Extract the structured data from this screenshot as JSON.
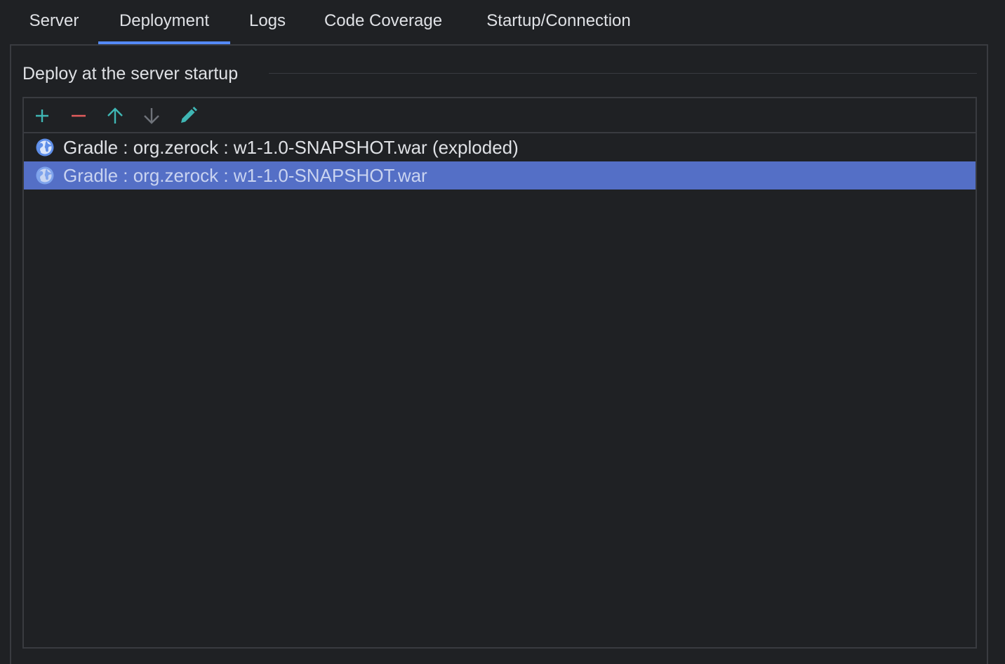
{
  "tabs": [
    {
      "label": "Server",
      "active": false
    },
    {
      "label": "Deployment",
      "active": true
    },
    {
      "label": "Logs",
      "active": false
    },
    {
      "label": "Code Coverage",
      "active": false
    },
    {
      "label": "Startup/Connection",
      "active": false
    }
  ],
  "deploy_group": {
    "title": "Deploy at the server startup",
    "toolbar": [
      {
        "icon": "add-icon",
        "color": "#3fb6b4"
      },
      {
        "icon": "remove-icon",
        "color": "#e35c5c"
      },
      {
        "icon": "move-up-icon",
        "color": "#3fb6b4"
      },
      {
        "icon": "move-down-icon",
        "color": "#6f737a"
      },
      {
        "icon": "edit-icon",
        "color": "#3fb6b4"
      }
    ],
    "artifacts": [
      {
        "label": "Gradle : org.zerock : w1-1.0-SNAPSHOT.war (exploded)",
        "icon": "web-globe-icon",
        "selected": false
      },
      {
        "label": "Gradle : org.zerock : w1-1.0-SNAPSHOT.war",
        "icon": "web-globe-icon",
        "selected": true
      }
    ]
  },
  "colors": {
    "background": "#1f2124",
    "accent": "#548af7",
    "selection": "#546fc6",
    "border": "#393b40"
  }
}
